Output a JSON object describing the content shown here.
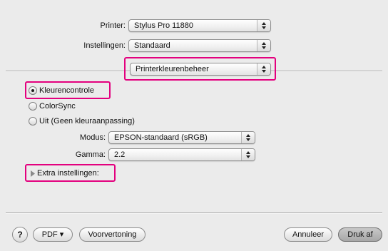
{
  "printer": {
    "label": "Printer:",
    "value": "Stylus Pro 11880"
  },
  "presets": {
    "label": "Instellingen:",
    "value": "Standaard"
  },
  "panel": {
    "value": "Printerkleurenbeheer"
  },
  "color_mode": {
    "options": [
      {
        "label": "Kleurencontrole",
        "selected": true
      },
      {
        "label": "ColorSync",
        "selected": false
      },
      {
        "label": "Uit (Geen kleuraanpassing)",
        "selected": false
      }
    ]
  },
  "modus": {
    "label": "Modus:",
    "value": "EPSON-standaard (sRGB)"
  },
  "gamma": {
    "label": "Gamma:",
    "value": "2.2"
  },
  "extra": {
    "label": "Extra instellingen:"
  },
  "footer": {
    "help": "?",
    "pdf": "PDF ▾",
    "preview": "Voorvertoning",
    "cancel": "Annuleer",
    "print": "Druk af"
  },
  "colors": {
    "highlight": "#e3007e",
    "background": "#ebebeb"
  },
  "icons": {
    "popup_arrows": "up-down-arrows-icon",
    "radio_selected": "radio-selected-icon",
    "disclosure": "disclosure-triangle-icon"
  }
}
